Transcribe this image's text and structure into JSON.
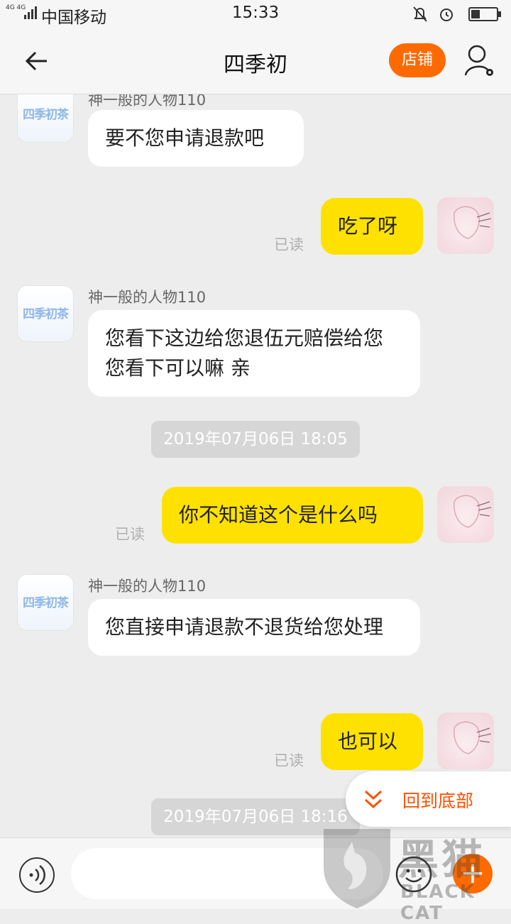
{
  "status_bar": {
    "network": "4G 4G",
    "carrier": "中国移动",
    "time": "15:33"
  },
  "header": {
    "title": "四季初",
    "shop_button": "店铺"
  },
  "shop_avatar_label": "四季初茶",
  "messages": [
    {
      "sender": "神一般的人物110",
      "text": "要不您申请退款吧"
    },
    {
      "text": "吃了呀",
      "read": "已读"
    },
    {
      "sender": "神一般的人物110",
      "text": "您看下这边给您退伍元赔偿给您 您看下可以嘛 亲"
    },
    {
      "timestamp": "2019年07月06日 18:05"
    },
    {
      "text": "你不知道这个是什么吗",
      "read": "已读"
    },
    {
      "sender": "神一般的人物110",
      "text": "您直接申请退款不退货给您处理"
    },
    {
      "text": "也可以",
      "read": "已读"
    },
    {
      "timestamp": "2019年07月06日 18:16"
    }
  ],
  "jump_to_bottom": "回到底部",
  "watermark": {
    "cn": "黑猫",
    "en": "BLACK CAT"
  },
  "colors": {
    "accent": "#ff6a00",
    "my_bubble": "#ffe100",
    "link": "#ff5000"
  }
}
